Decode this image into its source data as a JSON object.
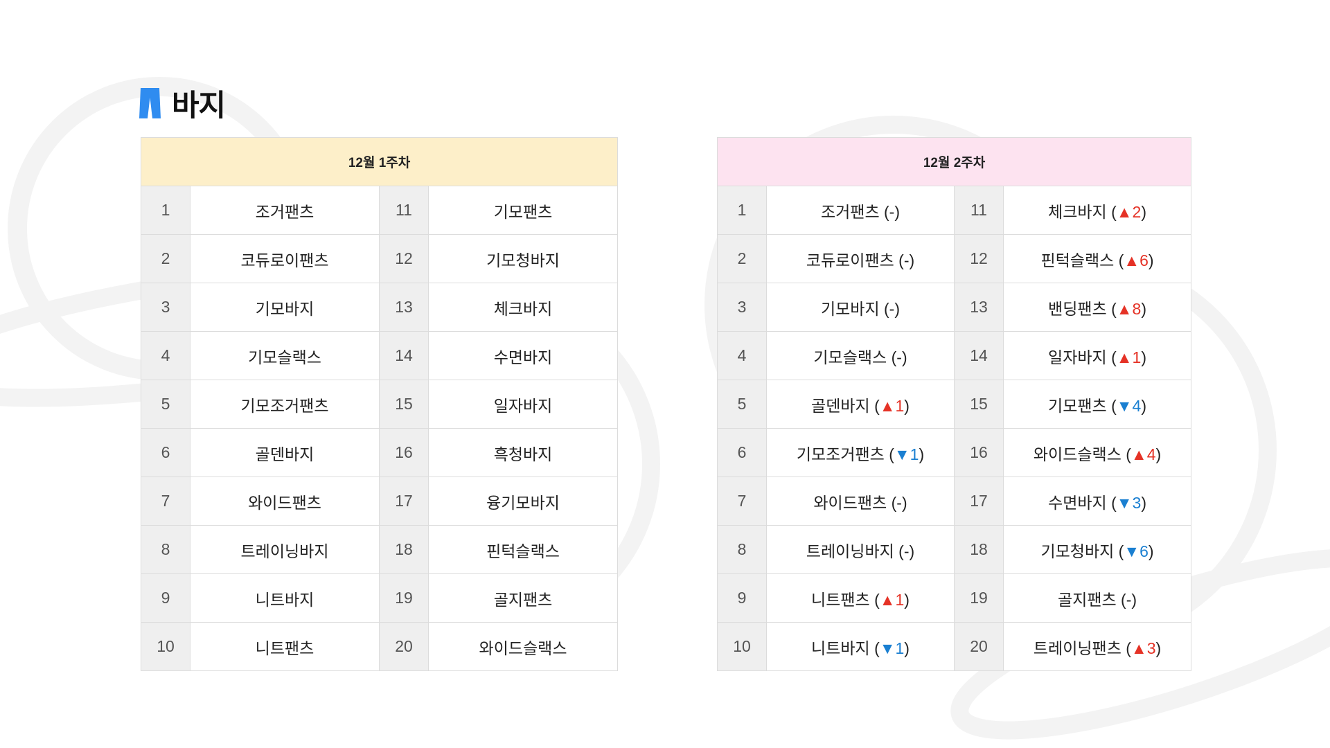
{
  "section": {
    "title": "바지",
    "icon": "pants-icon",
    "accent_color": "#2f8cf0"
  },
  "colors": {
    "week1_header_bg": "#fdefc9",
    "week2_header_bg": "#fde3f0",
    "rank_up": "#e53226",
    "rank_down": "#1a7fd1"
  },
  "week1": {
    "header": "12월 1주차",
    "items": [
      {
        "rank": "1",
        "name": "조거팬츠"
      },
      {
        "rank": "2",
        "name": "코듀로이팬츠"
      },
      {
        "rank": "3",
        "name": "기모바지"
      },
      {
        "rank": "4",
        "name": "기모슬랙스"
      },
      {
        "rank": "5",
        "name": "기모조거팬츠"
      },
      {
        "rank": "6",
        "name": "골덴바지"
      },
      {
        "rank": "7",
        "name": "와이드팬츠"
      },
      {
        "rank": "8",
        "name": "트레이닝바지"
      },
      {
        "rank": "9",
        "name": "니트바지"
      },
      {
        "rank": "10",
        "name": "니트팬츠"
      },
      {
        "rank": "11",
        "name": "기모팬츠"
      },
      {
        "rank": "12",
        "name": "기모청바지"
      },
      {
        "rank": "13",
        "name": "체크바지"
      },
      {
        "rank": "14",
        "name": "수면바지"
      },
      {
        "rank": "15",
        "name": "일자바지"
      },
      {
        "rank": "16",
        "name": "흑청바지"
      },
      {
        "rank": "17",
        "name": "융기모바지"
      },
      {
        "rank": "18",
        "name": "핀턱슬랙스"
      },
      {
        "rank": "19",
        "name": "골지팬츠"
      },
      {
        "rank": "20",
        "name": "와이드슬랙스"
      }
    ]
  },
  "week2": {
    "header": "12월 2주차",
    "items": [
      {
        "rank": "1",
        "name": "조거팬츠",
        "dir": "none",
        "amount": "-"
      },
      {
        "rank": "2",
        "name": "코듀로이팬츠",
        "dir": "none",
        "amount": "-"
      },
      {
        "rank": "3",
        "name": "기모바지",
        "dir": "none",
        "amount": "-"
      },
      {
        "rank": "4",
        "name": "기모슬랙스",
        "dir": "none",
        "amount": "-"
      },
      {
        "rank": "5",
        "name": "골덴바지",
        "dir": "up",
        "amount": "1"
      },
      {
        "rank": "6",
        "name": "기모조거팬츠",
        "dir": "down",
        "amount": "1"
      },
      {
        "rank": "7",
        "name": "와이드팬츠",
        "dir": "none",
        "amount": "-"
      },
      {
        "rank": "8",
        "name": "트레이닝바지",
        "dir": "none",
        "amount": "-"
      },
      {
        "rank": "9",
        "name": "니트팬츠",
        "dir": "up",
        "amount": "1"
      },
      {
        "rank": "10",
        "name": "니트바지",
        "dir": "down",
        "amount": "1"
      },
      {
        "rank": "11",
        "name": "체크바지",
        "dir": "up",
        "amount": "2"
      },
      {
        "rank": "12",
        "name": "핀턱슬랙스",
        "dir": "up",
        "amount": "6"
      },
      {
        "rank": "13",
        "name": "밴딩팬츠",
        "dir": "up",
        "amount": "8"
      },
      {
        "rank": "14",
        "name": "일자바지",
        "dir": "up",
        "amount": "1"
      },
      {
        "rank": "15",
        "name": "기모팬츠",
        "dir": "down",
        "amount": "4"
      },
      {
        "rank": "16",
        "name": "와이드슬랙스",
        "dir": "up",
        "amount": "4"
      },
      {
        "rank": "17",
        "name": "수면바지",
        "dir": "down",
        "amount": "3"
      },
      {
        "rank": "18",
        "name": "기모청바지",
        "dir": "down",
        "amount": "6"
      },
      {
        "rank": "19",
        "name": "골지팬츠",
        "dir": "none",
        "amount": "-"
      },
      {
        "rank": "20",
        "name": "트레이닝팬츠",
        "dir": "up",
        "amount": "3"
      }
    ]
  },
  "symbols": {
    "up": "▲",
    "down": "▼"
  }
}
